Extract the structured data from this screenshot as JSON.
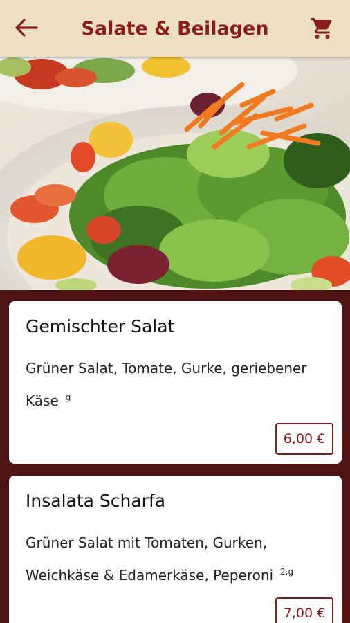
{
  "header": {
    "title": "Salate & Beilagen",
    "back_icon": "arrow-left-icon",
    "cart_icon": "cart-icon",
    "accent_color": "#8a1c1c",
    "background_color": "#ece0c0"
  },
  "hero": {
    "image": "salad-photo"
  },
  "items": [
    {
      "name": "Gemischter Salat",
      "description": "Grüner Salat, Tomate, Gurke, geriebener Käse",
      "allergens": "g",
      "price": "6,00 €"
    },
    {
      "name": "Insalata Scharfa",
      "description": "Grüner Salat mit Tomaten, Gurken, Weichkäse & Edamerkäse, Peperoni",
      "allergens": "2,g",
      "price": "7,00 €"
    }
  ]
}
